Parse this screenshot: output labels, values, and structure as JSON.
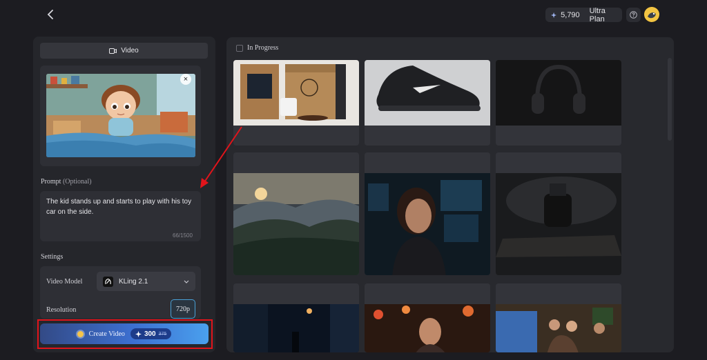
{
  "topbar": {
    "credits": "5,790",
    "plan": "Ultra Plan"
  },
  "left": {
    "tab_label": "Video",
    "prompt_label": "Prompt",
    "prompt_optional": "(Optional)",
    "prompt_text": "The kid stands up and starts to play with his toy car on the side.",
    "char_count": "66/1500",
    "settings_label": "Settings",
    "video_model_label": "Video Model",
    "video_model_value": "KLing 2.1",
    "resolution_label": "Resolution",
    "resolution_value": "720p",
    "create_label": "Create Video",
    "cost": "300",
    "cost_old": "375"
  },
  "right": {
    "in_progress_label": "In Progress"
  },
  "colors": {
    "accent": "#4aa2d8",
    "highlight": "#e1141b"
  }
}
